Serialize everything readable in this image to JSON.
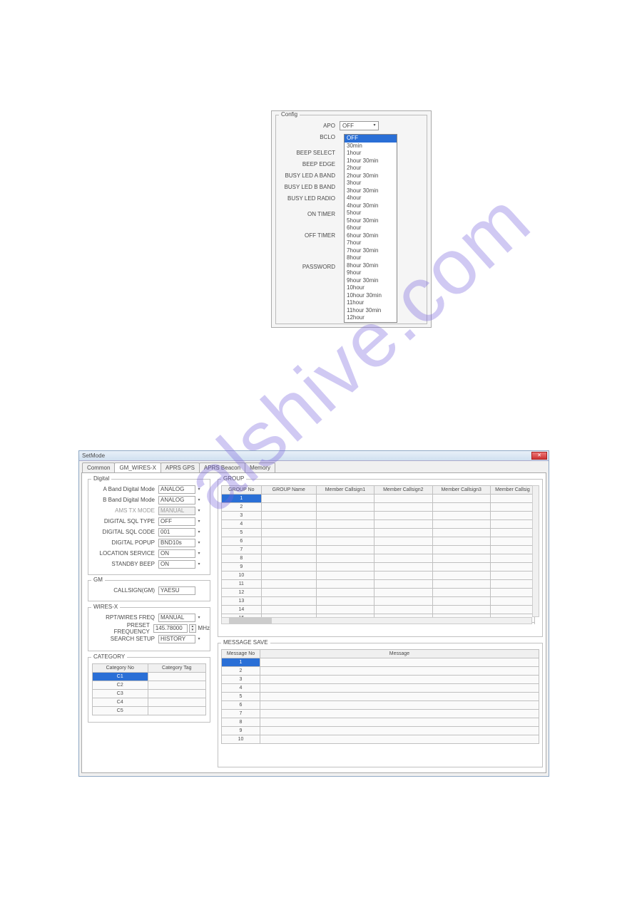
{
  "watermark": "alshive.com",
  "config": {
    "title": "Config",
    "rows": [
      {
        "label": "APO",
        "value": "OFF"
      },
      {
        "label": "BCLO",
        "value": ""
      },
      {
        "label": "BEEP SELECT",
        "value": ""
      },
      {
        "label": "BEEP EDGE",
        "value": ""
      },
      {
        "label": "BUSY LED A BAND",
        "value": ""
      },
      {
        "label": "BUSY LED B BAND",
        "value": ""
      },
      {
        "label": "BUSY LED RADIO",
        "value": ""
      },
      {
        "label": "ON TIMER",
        "value": ""
      },
      {
        "label": "OFF TIMER",
        "value": ""
      },
      {
        "label": "PASSWORD",
        "value": ""
      }
    ],
    "dropdown_options": [
      "OFF",
      "30min",
      "1hour",
      "1hour 30min",
      "2hour",
      "2hour 30min",
      "3hour",
      "3hour 30min",
      "4hour",
      "4hour 30min",
      "5hour",
      "5hour 30min",
      "6hour",
      "6hour 30min",
      "7hour",
      "7hour 30min",
      "8hour",
      "8hour 30min",
      "9hour",
      "9hour 30min",
      "10hour",
      "10hour 30min",
      "11hour",
      "11hour 30min",
      "12hour"
    ]
  },
  "setmode": {
    "title": "SetMode",
    "tabs": [
      "Common",
      "GM_WIRES-X",
      "APRS GPS",
      "APRS Beacon",
      "Memory"
    ],
    "active_tab": 1,
    "digital": {
      "title": "Digital",
      "rows": [
        {
          "label": "A Band Digital Mode",
          "value": "ANALOG"
        },
        {
          "label": "B Band Digital Mode",
          "value": "ANALOG"
        },
        {
          "label": "AMS TX MODE",
          "value": "MANUAL",
          "disabled": true
        },
        {
          "label": "DIGITAL SQL TYPE",
          "value": "OFF"
        },
        {
          "label": "DIGITAL SQL CODE",
          "value": "001"
        },
        {
          "label": "DIGITAL POPUP",
          "value": "BND10s"
        },
        {
          "label": "LOCATION SERVICE",
          "value": "ON"
        },
        {
          "label": "STANDBY BEEP",
          "value": "ON"
        }
      ]
    },
    "gm": {
      "title": "GM",
      "callsign_label": "CALLSIGN(GM)",
      "callsign_value": "YAESU"
    },
    "wiresx": {
      "title": "WIRES-X",
      "rows": [
        {
          "label": "RPT/WIRES FREQ",
          "value": "MANUAL"
        },
        {
          "label": "PRESET FREQUENCY",
          "value": "145.78000",
          "unit": "MHz"
        },
        {
          "label": "SEARCH SETUP",
          "value": "HISTORY"
        }
      ]
    },
    "category": {
      "title": "CATEGORY",
      "headers": [
        "Category No",
        "Category Tag"
      ],
      "rows": [
        "C1",
        "C2",
        "C3",
        "C4",
        "C5"
      ]
    },
    "group": {
      "title": "GROUP",
      "headers": [
        "GROUP No",
        "GROUP Name",
        "Member Callsign1",
        "Member Callsign2",
        "Member Callsign3",
        "Member Callsig"
      ],
      "count": 16
    },
    "msgsave": {
      "title": "MESSAGE SAVE",
      "headers": [
        "Message No",
        "Message"
      ],
      "count": 10
    }
  }
}
